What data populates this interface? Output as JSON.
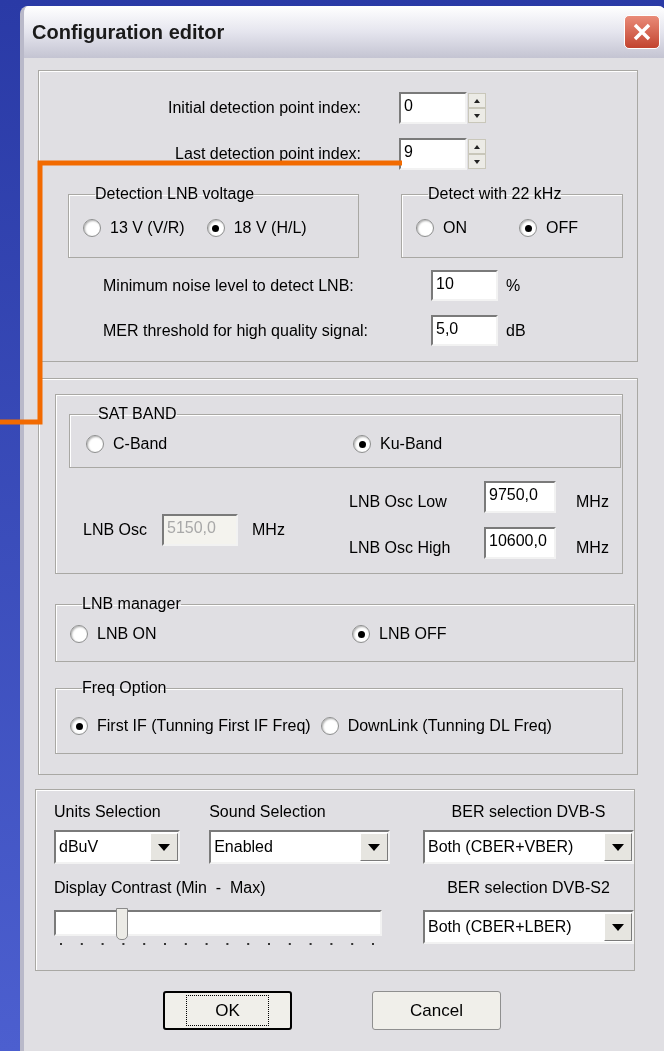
{
  "window": {
    "title": "Configuration editor"
  },
  "detection": {
    "initial": {
      "label": "Initial detection point index:",
      "value": "0"
    },
    "last": {
      "label": "Last detection point index:",
      "value": "9"
    },
    "lnb_voltage": {
      "title": "Detection LNB voltage",
      "options": [
        {
          "label": "13 V (V/R)",
          "selected": false
        },
        {
          "label": "18 V (H/L)",
          "selected": true
        }
      ]
    },
    "detect_22khz": {
      "title": "Detect with 22 kHz",
      "options": [
        {
          "label": "ON",
          "selected": false
        },
        {
          "label": "OFF",
          "selected": true
        }
      ]
    },
    "min_noise": {
      "label": "Minimum noise level to detect LNB:",
      "value": "10",
      "unit": "%"
    },
    "mer": {
      "label": "MER threshold for high quality signal:",
      "value": "5,0",
      "unit": "dB"
    }
  },
  "sat_band": {
    "title": "SAT BAND",
    "options": [
      {
        "label": "C-Band",
        "selected": false
      },
      {
        "label": "Ku-Band",
        "selected": true
      }
    ],
    "lnb_osc": {
      "label": "LNB Osc",
      "value": "5150,0",
      "unit": "MHz",
      "disabled": true
    },
    "lnb_osc_low": {
      "label": "LNB Osc Low",
      "value": "9750,0",
      "unit": "MHz",
      "disabled": false
    },
    "lnb_osc_high": {
      "label": "LNB Osc High",
      "value": "10600,0",
      "unit": "MHz",
      "disabled": false
    }
  },
  "lnb_manager": {
    "title": "LNB manager",
    "options": [
      {
        "label": "LNB ON",
        "selected": false
      },
      {
        "label": "LNB OFF",
        "selected": true
      }
    ]
  },
  "freq_option": {
    "title": "Freq Option",
    "options": [
      {
        "label": "First IF (Tunning First IF Freq)",
        "selected": true
      },
      {
        "label": "DownLink (Tunning DL Freq)",
        "selected": false
      }
    ]
  },
  "settings": {
    "units": {
      "label": "Units Selection",
      "value": "dBuV"
    },
    "sound": {
      "label": "Sound Selection",
      "value": "Enabled"
    },
    "ber_dvbs": {
      "label": "BER selection DVB-S",
      "value": "Both (CBER+VBER)"
    },
    "contrast": {
      "label": "Display Contrast (Min  -  Max)",
      "level": 0.2
    },
    "ber_dvbs2": {
      "label": "BER selection DVB-S2",
      "value": "Both (CBER+LBER)"
    }
  },
  "buttons": [
    {
      "label": "OK",
      "focused": true
    },
    {
      "label": "Cancel",
      "focused": false
    }
  ]
}
